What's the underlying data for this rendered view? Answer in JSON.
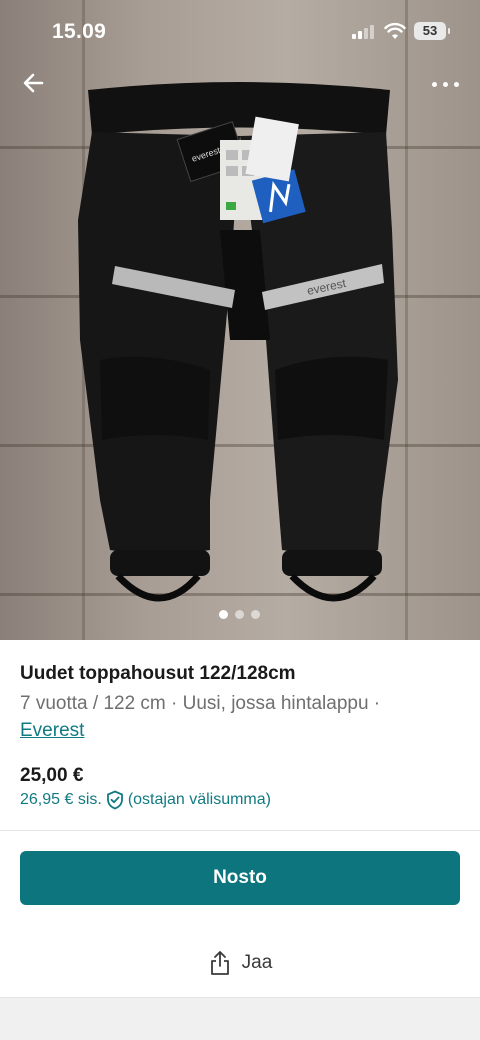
{
  "status_bar": {
    "time": "15.09",
    "battery": "53"
  },
  "carousel": {
    "count": 3,
    "active_index": 0
  },
  "photo": {
    "tag_brand": "everest",
    "stripe_brand": "everest"
  },
  "listing": {
    "title": "Uudet toppahousut 122/128cm",
    "meta_text": "7 vuotta / 122 cm · Uusi, jossa hintalappu ·",
    "brand": "Everest",
    "price": "25,00 €",
    "price_incl": "26,95 € sis.",
    "price_incl_note": "(ostajan välisumma)"
  },
  "actions": {
    "buy_label": "Nosto",
    "share_label": "Jaa"
  },
  "colors": {
    "accent": "#0d757d",
    "link": "#127a82"
  }
}
